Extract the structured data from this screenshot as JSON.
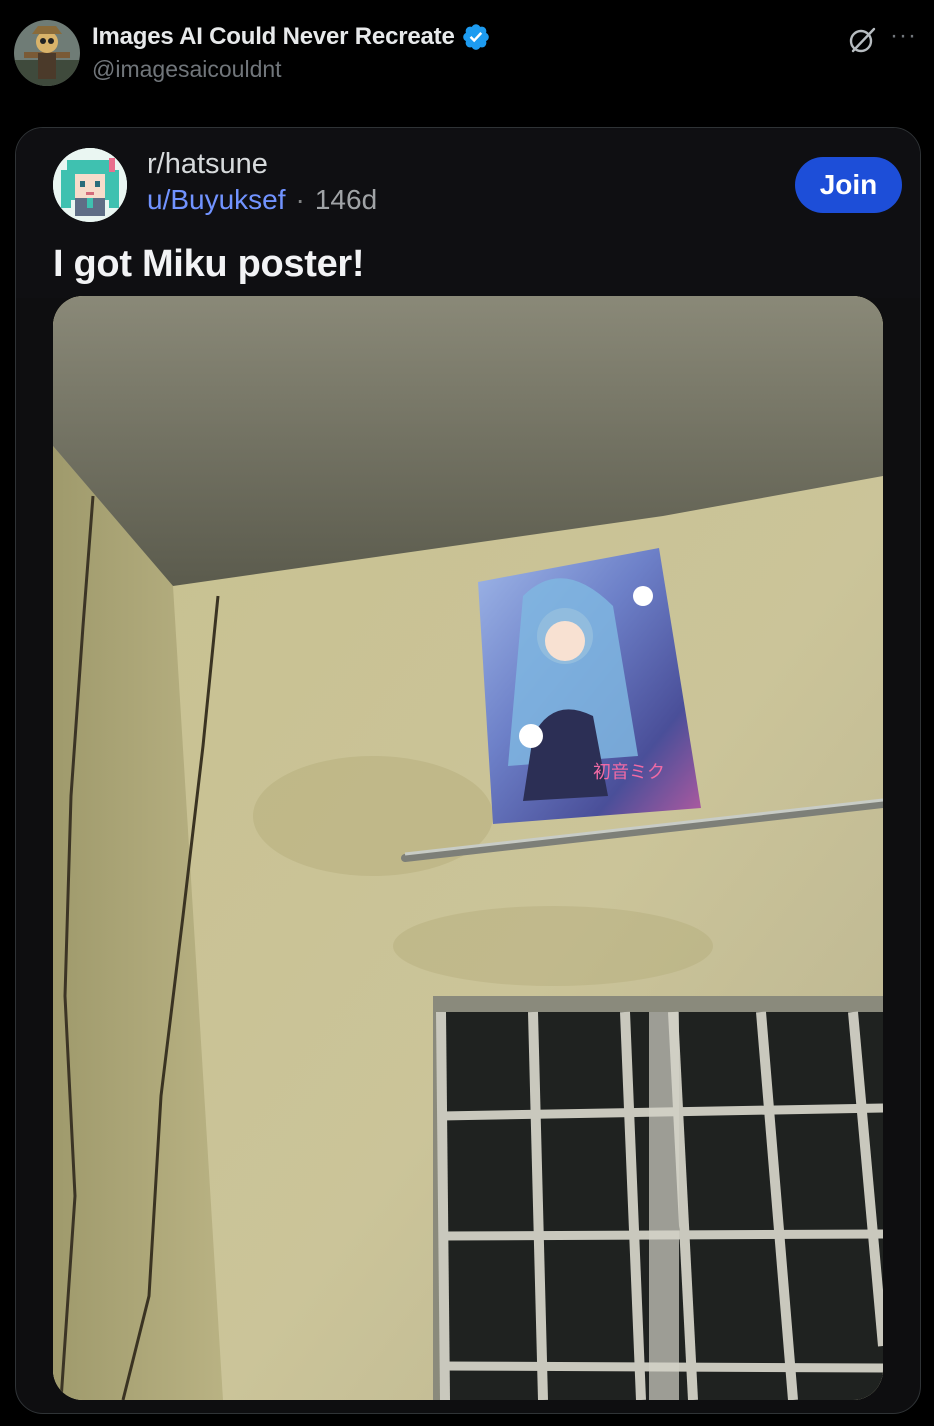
{
  "tweet": {
    "display_name": "Images AI Could Never Recreate",
    "handle": "@imagesaicouldnt",
    "verified": true,
    "avatar_icon": "scarecrow-avatar-icon",
    "more_label": "···"
  },
  "embed": {
    "subreddit": "r/hatsune",
    "username": "u/Buyuksef",
    "separator": "·",
    "age": "146d",
    "join_label": "Join",
    "title": "I got Miku poster!",
    "avatar_icon": "pixel-miku-avatar-icon",
    "colors": {
      "join": "#1d4ed8",
      "username": "#7193ff"
    }
  },
  "photo": {
    "poster_text": "初音ミク"
  }
}
